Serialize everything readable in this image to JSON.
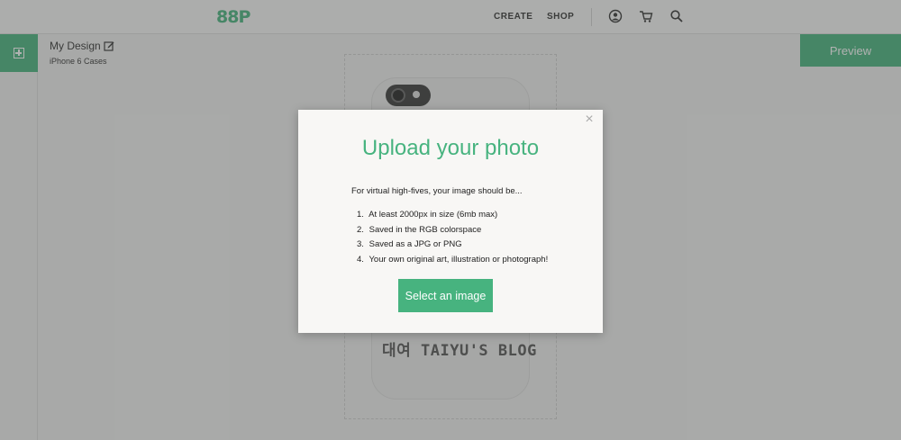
{
  "header": {
    "logo_text": "88P",
    "nav": {
      "create": "CREATE",
      "shop": "SHOP"
    },
    "icons": [
      "user-icon",
      "cart-icon",
      "search-icon"
    ]
  },
  "design": {
    "title": "My Design",
    "product": "iPhone 6 Cases"
  },
  "toolbar": {
    "preview_label": "Preview"
  },
  "canvas": {
    "phone_text": "대여 TAIYU'S BLOG"
  },
  "modal": {
    "close_label": "×",
    "title": "Upload your photo",
    "intro": "For virtual high-fives, your image should be...",
    "requirements": [
      {
        "num": "1.",
        "text": "At least 2000px in size (6mb max)"
      },
      {
        "num": "2.",
        "text": "Saved in the RGB colorspace"
      },
      {
        "num": "3.",
        "text": "Saved as a JPG or PNG"
      },
      {
        "num": "4.",
        "text": "Your own original art, illustration or photograph!"
      }
    ],
    "button_label": "Select an image"
  },
  "colors": {
    "accent": "#47b37f",
    "overlay": "rgba(70,72,70,0.42)",
    "modal_bg": "#f8f7f5"
  }
}
